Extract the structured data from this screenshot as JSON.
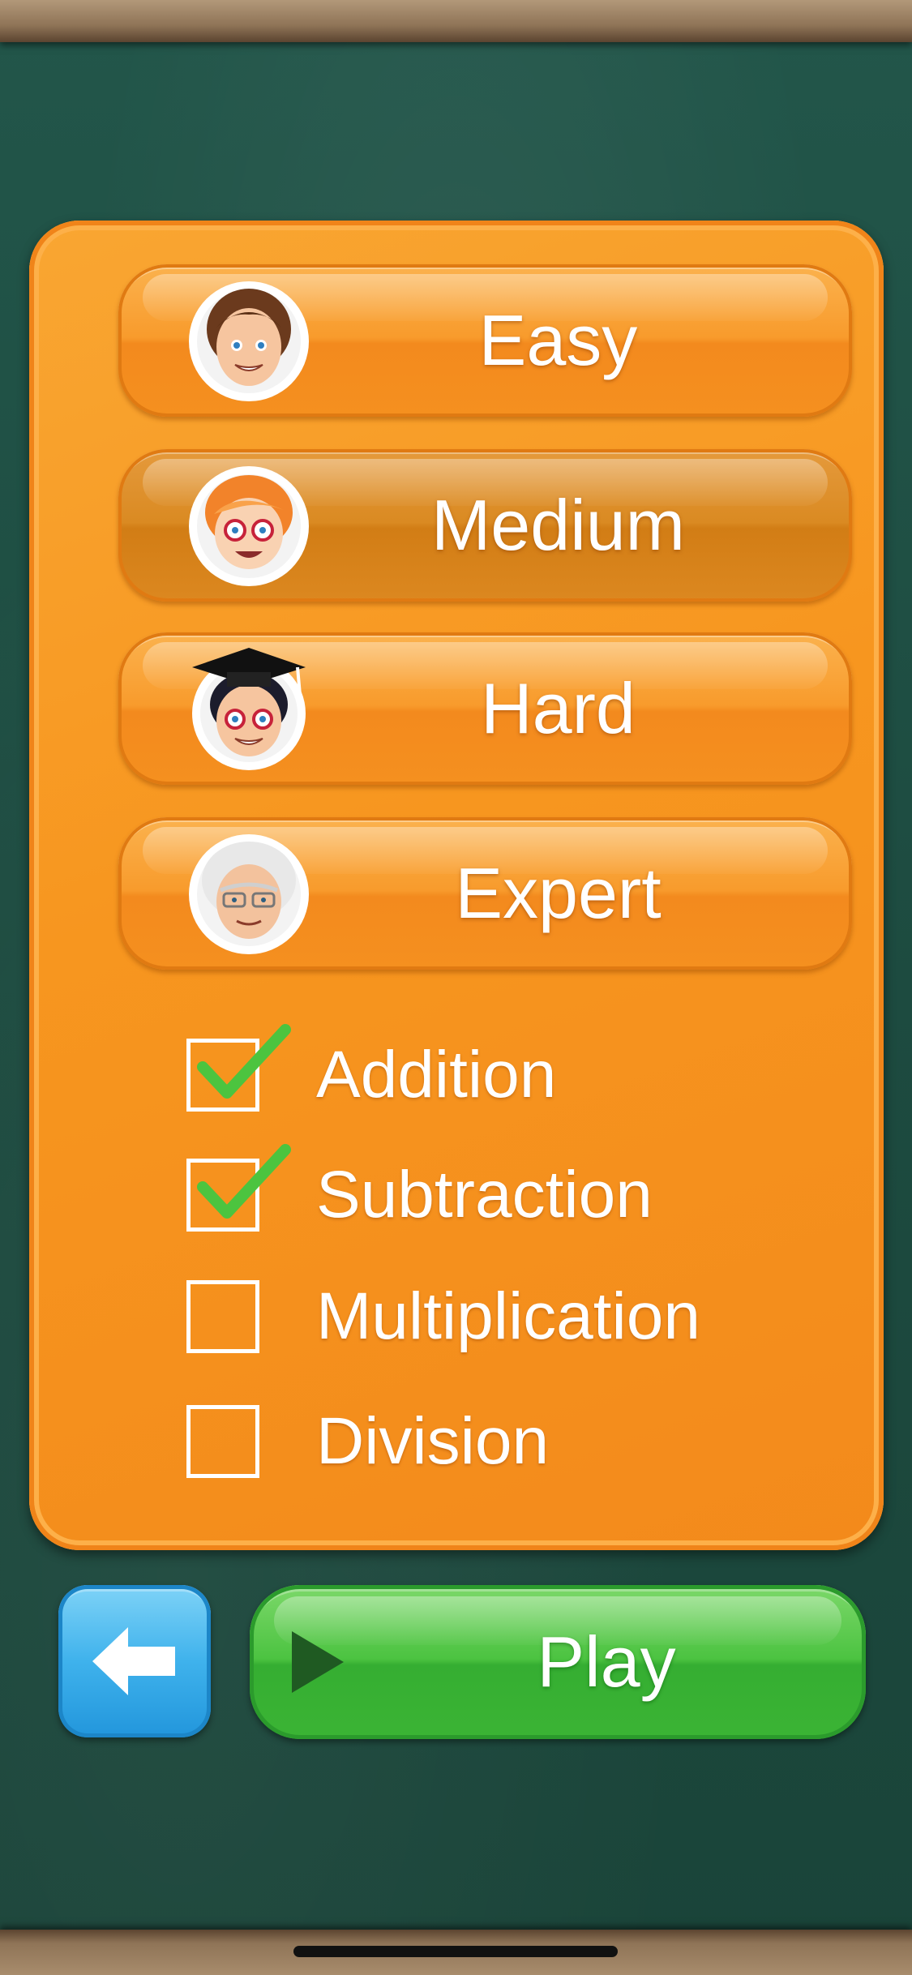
{
  "levels": [
    {
      "label": "Easy",
      "avatar": "curly-hair-boy-avatar",
      "selected": false
    },
    {
      "label": "Medium",
      "avatar": "red-hair-glasses-girl-avatar",
      "selected": true
    },
    {
      "label": "Hard",
      "avatar": "graduate-cap-student-avatar",
      "selected": false
    },
    {
      "label": "Expert",
      "avatar": "white-hair-professor-avatar",
      "selected": false
    }
  ],
  "operations": [
    {
      "label": "Addition",
      "checked": true
    },
    {
      "label": "Subtraction",
      "checked": true
    },
    {
      "label": "Multiplication",
      "checked": false
    },
    {
      "label": "Division",
      "checked": false
    }
  ],
  "footer": {
    "back_icon": "arrow-left-icon",
    "play_icon": "play-triangle-icon",
    "play_label": "Play"
  },
  "colors": {
    "panel_orange": "#f7961f",
    "board_green": "#1f4f44",
    "play_green": "#4cc341",
    "back_blue": "#3fb2ec",
    "check_green": "#4cc43f"
  }
}
